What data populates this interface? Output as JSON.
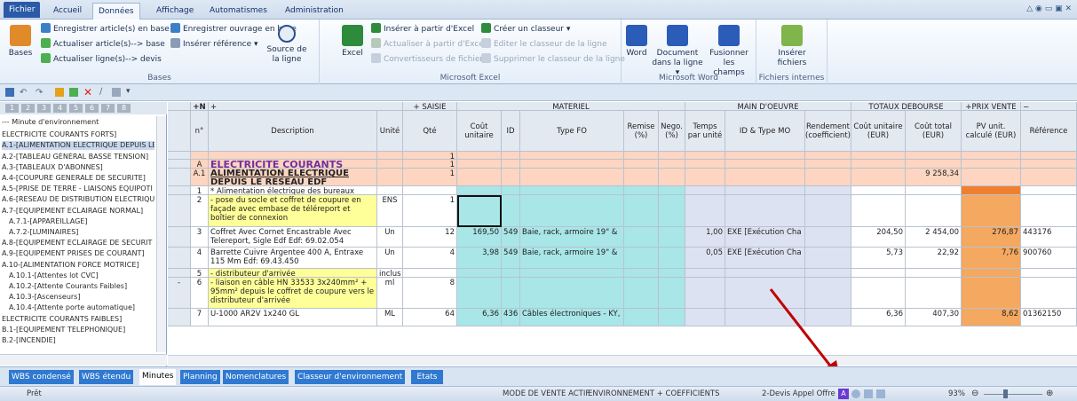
{
  "ribbon_tabs": [
    "Fichier",
    "Accueil",
    "Données",
    "Affichage",
    "Automatismes",
    "Administration"
  ],
  "bases": {
    "big": "Bases",
    "items": [
      "Enregistrer article(s) en base",
      "Actualiser article(s)--> base",
      "Actualiser ligne(s)--> devis"
    ],
    "col2": [
      "Enregistrer ouvrage en base",
      "Insérer référence ▾"
    ],
    "source": "Source de la ligne",
    "label": "Bases"
  },
  "excel": {
    "big": "Excel",
    "items": [
      "Insérer à partir d'Excel",
      "Actualiser à partir d'Excel",
      "Convertisseurs de fichiers"
    ],
    "col2": [
      "Créer un classeur ▾",
      "Editer le classeur de la ligne",
      "Supprimer le classeur de la ligne"
    ],
    "label": "Microsoft Excel"
  },
  "word": {
    "items": [
      "Word",
      "Document dans la ligne ▾",
      "Fusionner les champs"
    ],
    "label": "Microsoft Word"
  },
  "internes": {
    "item": "Insérer fichiers",
    "label": "Fichiers internes"
  },
  "levels": [
    "1",
    "2",
    "3",
    "4",
    "5",
    "6",
    "7",
    "8"
  ],
  "tree": [
    "--- Minute d'environnement",
    "ELECTRICITE COURANTS FORTS]",
    "A.1-[ALIMENTATION ELECTRIQUE DEPUIS LE",
    "A.2-[TABLEAU GÉNÉRAL BASSE TENSION]",
    "A.3-[TABLEAUX D'ABONNES]",
    "A.4-[COUPURE GENERALE DE SECURITE]",
    "A.5-[PRISE DE TERRE - LIAISONS EQUIPOTI",
    "A.6-[RESEAU DE DISTRIBUTION ELECTRIQU",
    "A.7-[EQUIPEMENT ECLAIRAGE NORMAL]",
    "A.7.1-[APPAREILLAGE]",
    "A.7.2-[LUMINAIRES]",
    "A.8-[EQUIPEMENT ECLAIRAGE DE SECURIT",
    "A.9-[EQUIPEMENT PRISES DE COURANT]",
    "A.10-[ALIMENTATION FORCE MOTRICE]",
    "A.10.1-[Attentes lot CVC]",
    "A.10.2-[Attente Courants Faibles]",
    "A.10.3-[Ascenseurs]",
    "A.10.4-[Attente porte automatique]",
    "ELECTRICITE COURANTS FAIBLES]",
    "B.1-[EQUIPEMENT TELEPHONIQUE]",
    "B.2-[INCENDIE]"
  ],
  "group_headers": {
    "saisie": "SAISIE",
    "materiel": "MATERIEL",
    "main": "MAIN D'OEUVRE",
    "totaux": "TOTAUX DEBOURSE",
    "prix": "PRIX VENTE"
  },
  "columns": [
    "n°",
    "Description",
    "Unité",
    "Qté",
    "Coût unitaire",
    "ID",
    "Type FO",
    "Remise (%)",
    "Nego. (%)",
    "Temps par unité",
    "ID & Type MO",
    "Rendement (coefficient)",
    "Coût unitaire (EUR)",
    "Coût total (EUR)",
    "PV unit. calculé (EUR)",
    "Référence"
  ],
  "rows": [
    {
      "n": "",
      "desc": "",
      "unit": "",
      "qte": "1"
    },
    {
      "n": "A",
      "desc": "ELECTRICITE COURANTS FORTS",
      "qte": "1"
    },
    {
      "n": "A.1",
      "desc": "ALIMENTATION ELECTRIQUE DEPUIS LE RESEAU EDF",
      "qte": "1",
      "total": "9 258,34"
    },
    {
      "n": "1",
      "desc": "* Alimentation électrique des bureaux"
    },
    {
      "n": "2",
      "desc": "- pose du socle et coffret de coupure en façade avec embase de téléreport et boîtier de connexion",
      "unit": "ENS",
      "qte": "1"
    },
    {
      "n": "3",
      "desc": "Coffret Avec Cornet Encastrable Avec Telereport, Sigle Edf Edf: 69.02.054",
      "unit": "Un",
      "qte": "12",
      "cu": "169,50",
      "id": "549",
      "fo": "Baie, rack, armoire 19\" &",
      "temps": "1,00",
      "mo": "EXE  [Exécution Cha",
      "cue": "204,50",
      "ct": "2 454,00",
      "pv": "276,87",
      "ref": "443176"
    },
    {
      "n": "4",
      "desc": "Barrette Cuivre Argentee 400 A, Entraxe 115 Mm Edf: 69.43.450",
      "unit": "Un",
      "qte": "4",
      "cu": "3,98",
      "id": "549",
      "fo": "Baie, rack, armoire 19\" &",
      "temps": "0,05",
      "mo": "EXE  [Exécution Cha",
      "cue": "5,73",
      "ct": "22,92",
      "pv": "7,76",
      "ref": "900760"
    },
    {
      "n": "5",
      "desc": "- distributeur d'arrivée",
      "unit": "inclus"
    },
    {
      "n": "6",
      "desc": "- liaison en câble HN 33533 3x240mm² + 95mm² depuis le coffret  de coupure vers le distributeur d'arrivée",
      "unit": "ml",
      "qte": "8"
    },
    {
      "n": "7",
      "desc": "U-1000 AR2V 1x240 GL",
      "unit": "ML",
      "qte": "64",
      "cu": "6,36",
      "id": "436",
      "fo": "Câbles électroniques - KY,",
      "cue": "6,36",
      "ct": "407,30",
      "pv": "8,62",
      "ref": "01362150"
    }
  ],
  "sheet_tabs": [
    "WBS condensé",
    "WBS étendu",
    "Minutes",
    "Planning",
    "Nomenclatures",
    "Classeur d'environnement",
    "Etats"
  ],
  "status": {
    "left": "Prêt",
    "mode": "MODE DE VENTE ACTIF",
    "env": "ENVIRONNEMENT + COEFFICIENTS",
    "devis": "2-Devis Appel Offre",
    "zoom": "93%"
  },
  "colors": {
    "salmon": "#fdd5c0",
    "cyan": "#a8e6e8",
    "yellow": "#ffff99",
    "orange": "#f5a860",
    "purple": "#7030a0",
    "arrow": "#c00000"
  }
}
